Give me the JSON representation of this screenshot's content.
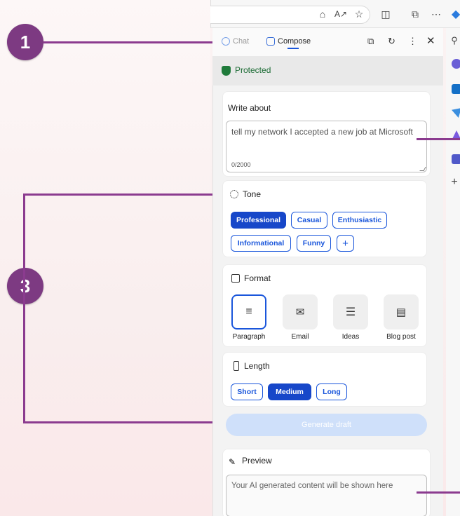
{
  "annotations": {
    "callout_1": "1",
    "callout_3": "3"
  },
  "panel": {
    "tabs": [
      {
        "label": "Chat"
      },
      {
        "label": "Compose"
      }
    ],
    "header_icons": [
      "open-in-new-icon",
      "refresh-icon",
      "more-icon",
      "close-icon"
    ],
    "status": "Protected",
    "write_about": {
      "label": "Write about",
      "value": "tell my network I accepted a new job at Microsoft",
      "counter": "0/2000"
    },
    "tone": {
      "label": "Tone",
      "options": [
        "Professional",
        "Casual",
        "Enthusiastic",
        "Informational",
        "Funny",
        "+"
      ],
      "selected": "Professional"
    },
    "format": {
      "label": "Format",
      "options": [
        "Paragraph",
        "Email",
        "Ideas",
        "Blog post"
      ],
      "selected": "Paragraph"
    },
    "length": {
      "label": "Length",
      "options": [
        "Short",
        "Medium",
        "Long"
      ],
      "selected": "Medium"
    },
    "generate_label": "Generate draft",
    "preview": {
      "label": "Preview",
      "placeholder": "Your AI generated content will be shown here"
    }
  },
  "sidebar": {
    "add_label": "+"
  },
  "colors": {
    "accent": "#1747c9",
    "annotation": "#7d3a82",
    "protected": "#1b6b34"
  }
}
